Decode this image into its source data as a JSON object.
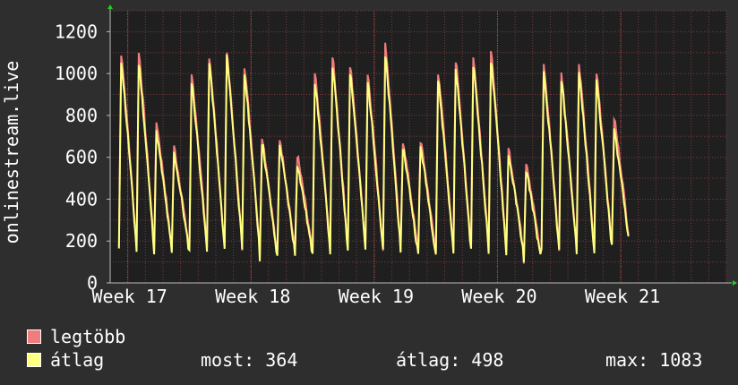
{
  "colors": {
    "background": "#2e2e2e",
    "plot_background": "#1f1f1f",
    "grid": "#7a3a3a",
    "axis": "#bbbbbb",
    "max_series": "#f07c7c",
    "avg_series": "#ffff80",
    "arrow": "#22cc22"
  },
  "chart_data": {
    "type": "line",
    "ylabel": "onlinestream.live",
    "ylim": [
      0,
      1300
    ],
    "yticks": [
      0,
      200,
      400,
      600,
      800,
      1000,
      1200
    ],
    "xlim": [
      0,
      35
    ],
    "x_ticks": [
      {
        "label": "Week 17",
        "day": 1
      },
      {
        "label": "Week 18",
        "day": 8
      },
      {
        "label": "Week 19",
        "day": 15
      },
      {
        "label": "Week 20",
        "day": 22
      },
      {
        "label": "Week 21",
        "day": 29
      }
    ],
    "daily_peaks_max": [
      1100,
      1100,
      770,
      650,
      1000,
      1080,
      1100,
      1040,
      700,
      690,
      610,
      1000,
      1080,
      1040,
      1000,
      1140,
      680,
      680,
      1010,
      1060,
      1080,
      1100,
      640,
      580,
      1040,
      1000,
      1040,
      1000,
      790
    ],
    "daily_peaks_avg": [
      1060,
      1050,
      720,
      620,
      960,
      1050,
      1080,
      1000,
      670,
      660,
      570,
      960,
      1040,
      1010,
      960,
      1080,
      650,
      650,
      970,
      1020,
      1040,
      1060,
      610,
      540,
      1000,
      970,
      1000,
      960,
      730
    ],
    "daily_troughs": [
      160,
      150,
      150,
      140,
      150,
      150,
      160,
      150,
      110,
      140,
      130,
      150,
      150,
      160,
      150,
      150,
      130,
      130,
      140,
      150,
      150,
      150,
      130,
      90,
      150,
      150,
      150,
      150,
      180
    ],
    "series": [
      {
        "name": "legtöbb",
        "color": "#f07c7c"
      },
      {
        "name": "átlag",
        "color": "#ffff80"
      }
    ]
  },
  "legend": {
    "items": [
      {
        "label": "legtöbb",
        "color": "#f07c7c"
      },
      {
        "label": "átlag",
        "color": "#ffff80"
      }
    ],
    "current_label": "most:",
    "current_value": "364",
    "average_label": "átlag:",
    "average_value": "498",
    "max_label": "max:",
    "max_value": "1083"
  }
}
